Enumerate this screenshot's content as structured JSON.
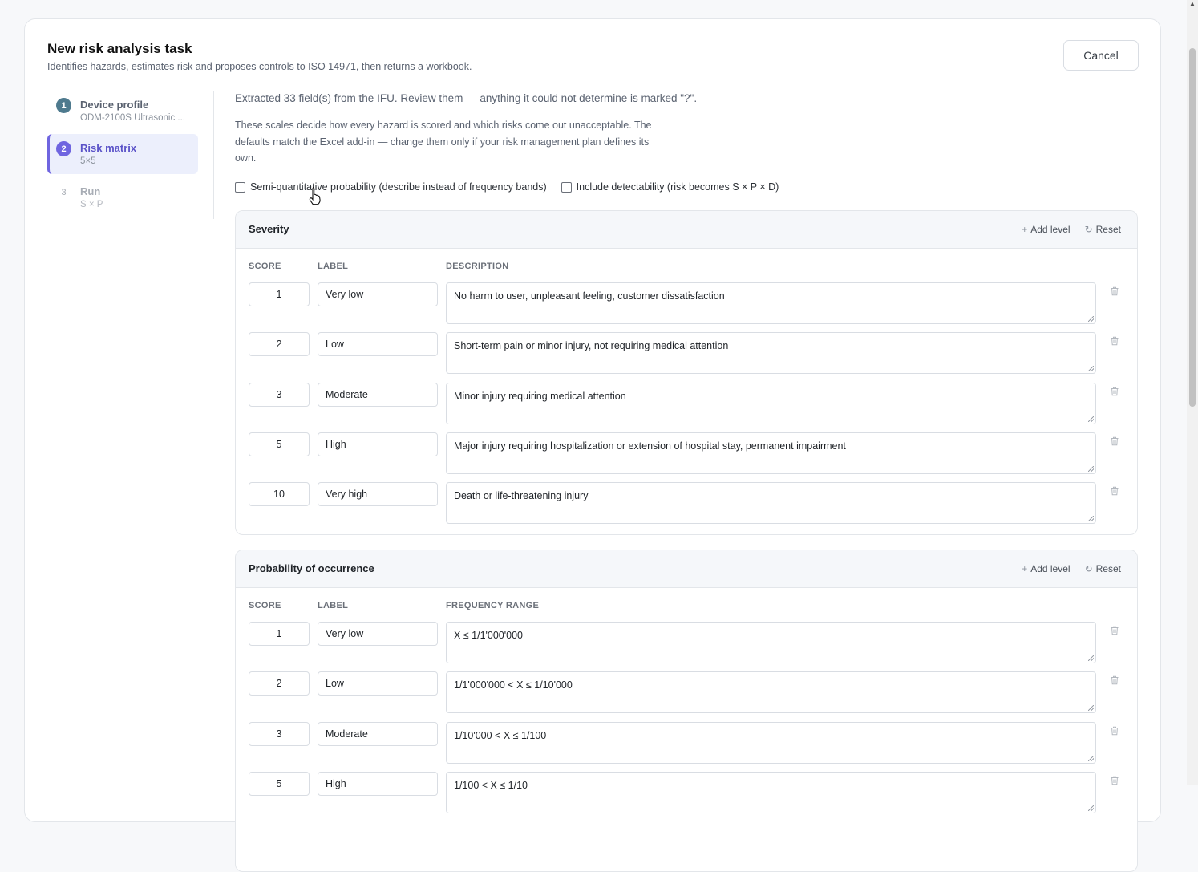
{
  "header": {
    "title": "New risk analysis task",
    "subtitle": "Identifies hazards, estimates risk and proposes controls to ISO 14971, then returns a workbook.",
    "cancel_label": "Cancel"
  },
  "steps": [
    {
      "num": "1",
      "label": "Device profile",
      "sub": "ODM-2100S Ultrasonic ...",
      "state": "done"
    },
    {
      "num": "2",
      "label": "Risk matrix",
      "sub": "5×5",
      "state": "active"
    },
    {
      "num": "3",
      "label": "Run",
      "sub": "S × P",
      "state": "pending"
    }
  ],
  "main": {
    "extracted_note": "Extracted 33 field(s) from the IFU. Review them — anything it could not determine is marked \"?\".",
    "intro": "These scales decide how every hazard is scored and which risks come out unacceptable. The defaults match the Excel add-in — change them only if your risk management plan defines its own.",
    "options": [
      {
        "label": "Semi-quantitative probability (describe instead of frequency bands)",
        "checked": false
      },
      {
        "label": "Include detectability (risk becomes S × P × D)",
        "checked": false
      }
    ]
  },
  "severity": {
    "title": "Severity",
    "add_label": "Add level",
    "reset_label": "Reset",
    "col_score": "SCORE",
    "col_label": "LABEL",
    "col_desc": "DESCRIPTION",
    "rows": [
      {
        "score": "1",
        "label": "Very low",
        "desc": "No harm to user, unpleasant feeling, customer dissatisfaction"
      },
      {
        "score": "2",
        "label": "Low",
        "desc": "Short-term pain or minor injury, not requiring medical attention"
      },
      {
        "score": "3",
        "label": "Moderate",
        "desc": "Minor injury requiring medical attention"
      },
      {
        "score": "5",
        "label": "High",
        "desc": "Major injury requiring hospitalization or extension of hospital stay, permanent impairment"
      },
      {
        "score": "10",
        "label": "Very high",
        "desc": "Death or life-threatening injury"
      }
    ]
  },
  "probability": {
    "title": "Probability of occurrence",
    "add_label": "Add level",
    "reset_label": "Reset",
    "col_score": "SCORE",
    "col_label": "LABEL",
    "col_desc": "FREQUENCY RANGE",
    "rows": [
      {
        "score": "1",
        "label": "Very low",
        "desc": "X ≤ 1/1'000'000"
      },
      {
        "score": "2",
        "label": "Low",
        "desc": "1/1'000'000 < X ≤ 1/10'000"
      },
      {
        "score": "3",
        "label": "Moderate",
        "desc": "1/10'000 < X ≤ 1/100"
      },
      {
        "score": "5",
        "label": "High",
        "desc": "1/100 < X ≤ 1/10"
      }
    ]
  }
}
